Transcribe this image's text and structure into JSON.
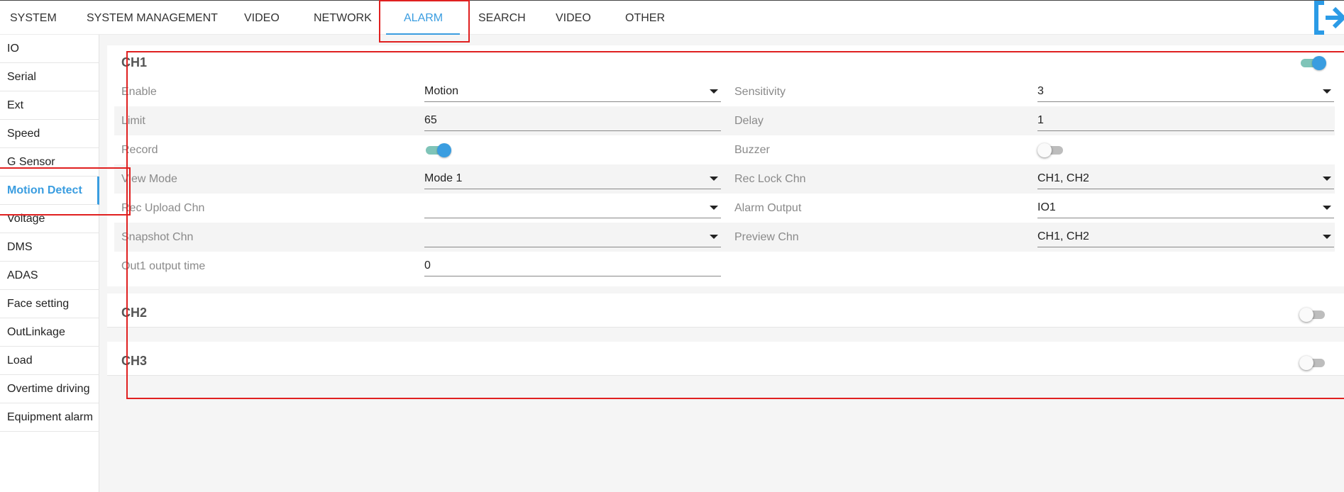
{
  "topnav": {
    "tabs": [
      "SYSTEM",
      "SYSTEM MANAGEMENT",
      "VIDEO",
      "NETWORK",
      "ALARM",
      "SEARCH",
      "VIDEO",
      "OTHER"
    ],
    "active": "ALARM",
    "accent_color": "#3a9de0",
    "logout_icon": "logout-icon"
  },
  "sidebar": {
    "items": [
      "IO",
      "Serial",
      "Ext",
      "Speed",
      "G Sensor",
      "Motion Detect",
      "Voltage",
      "DMS",
      "ADAS",
      "Face setting",
      "OutLinkage",
      "Load",
      "Overtime driving",
      "Equipment alarm"
    ],
    "active": "Motion Detect"
  },
  "channels": [
    {
      "title": "CH1",
      "enabled": true,
      "fields": {
        "enable_label": "Enable",
        "enable_value": "Motion",
        "sensitivity_label": "Sensitivity",
        "sensitivity_value": "3",
        "limit_label": "Limit",
        "limit_value": "65",
        "delay_label": "Delay",
        "delay_value": "1",
        "record_label": "Record",
        "record_on": true,
        "buzzer_label": "Buzzer",
        "buzzer_on": false,
        "view_mode_label": "View Mode",
        "view_mode_value": "Mode 1",
        "rec_lock_label": "Rec Lock Chn",
        "rec_lock_value": "CH1, CH2",
        "rec_upload_label": "Rec Upload Chn",
        "rec_upload_value": "",
        "alarm_output_label": "Alarm Output",
        "alarm_output_value": "IO1",
        "snapshot_label": "Snapshot Chn",
        "snapshot_value": "",
        "preview_label": "Preview Chn",
        "preview_value": "CH1, CH2",
        "out1_label": "Out1 output time",
        "out1_value": "0"
      }
    },
    {
      "title": "CH2",
      "enabled": false
    },
    {
      "title": "CH3",
      "enabled": false
    }
  ],
  "colors": {
    "highlight_box": "#e02020",
    "switch_on_knob": "#3a9de0",
    "switch_on_track": "#7fc4b8"
  }
}
